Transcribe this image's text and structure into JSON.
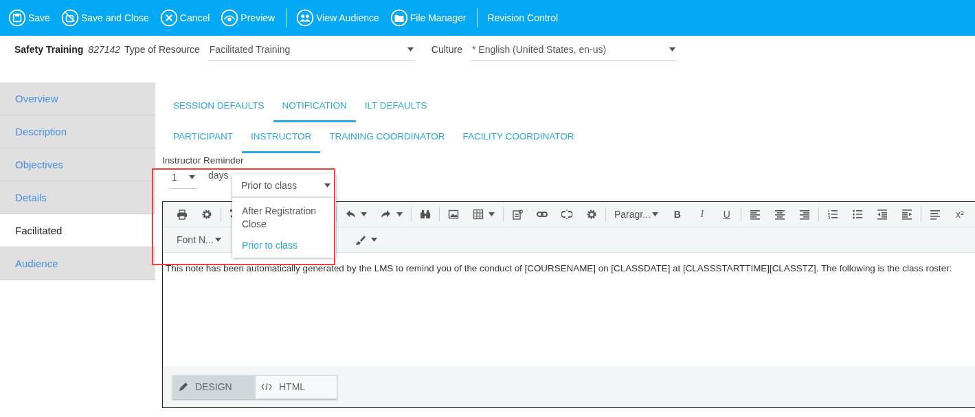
{
  "toolbar": {
    "buttons": [
      {
        "label": "Save"
      },
      {
        "label": "Save and Close"
      },
      {
        "label": "Cancel"
      },
      {
        "label": "Preview"
      },
      {
        "label": "View Audience"
      },
      {
        "label": "File Manager"
      },
      {
        "label": "Revision Control"
      }
    ]
  },
  "header": {
    "title": "Safety Training",
    "code": "827142",
    "type_label": "Type of Resource",
    "type_value": "Facilitated Training",
    "culture_label": "Culture",
    "culture_value": "* English (United States, en-us)"
  },
  "sidebar": {
    "items": [
      {
        "label": "Overview",
        "selected": false
      },
      {
        "label": "Description",
        "selected": false
      },
      {
        "label": "Objectives",
        "selected": false
      },
      {
        "label": "Details",
        "selected": false
      },
      {
        "label": "Facilitated",
        "selected": true
      },
      {
        "label": "Audience",
        "selected": false
      }
    ]
  },
  "tabs": [
    {
      "label": "SESSION DEFAULTS",
      "selected": false
    },
    {
      "label": "NOTIFICATION",
      "selected": true
    },
    {
      "label": "ILT DEFAULTS",
      "selected": false
    }
  ],
  "subtabs": [
    {
      "label": "PARTICIPANT",
      "selected": false
    },
    {
      "label": "INSTRUCTOR",
      "selected": true
    },
    {
      "label": "TRAINING COORDINATOR",
      "selected": false
    },
    {
      "label": "FACILITY COORDINATOR",
      "selected": false
    }
  ],
  "reminder": {
    "label": "Instructor Reminder",
    "count": "1",
    "unit": "days",
    "timing": "Prior to class",
    "options": [
      {
        "label": "After Registration Close",
        "selected": false
      },
      {
        "label": "Prior to class",
        "selected": true
      }
    ]
  },
  "editor": {
    "toolbar_1": [
      {
        "kind": "print"
      },
      {
        "kind": "gear"
      },
      {
        "kind": "sep"
      },
      {
        "kind": "spell"
      },
      {
        "kind": "gap"
      },
      {
        "kind": "sep"
      },
      {
        "kind": "undo"
      },
      {
        "kind": "redo"
      },
      {
        "kind": "sep"
      },
      {
        "kind": "binoculars"
      },
      {
        "kind": "sep"
      },
      {
        "kind": "image"
      },
      {
        "kind": "table"
      },
      {
        "kind": "sep"
      },
      {
        "kind": "paste"
      },
      {
        "kind": "link"
      },
      {
        "kind": "unlink"
      },
      {
        "kind": "gear"
      },
      {
        "kind": "sep"
      },
      {
        "kind": "format",
        "text": "Paragr..."
      },
      {
        "kind": "bold",
        "text": "B"
      },
      {
        "kind": "italic",
        "text": "I"
      },
      {
        "kind": "underline",
        "text": "U"
      },
      {
        "kind": "sep"
      },
      {
        "kind": "alignleft"
      },
      {
        "kind": "aligncenter"
      },
      {
        "kind": "alignright"
      },
      {
        "kind": "sep"
      },
      {
        "kind": "ol"
      },
      {
        "kind": "ul"
      },
      {
        "kind": "outdent"
      },
      {
        "kind": "indent"
      },
      {
        "kind": "sep"
      },
      {
        "kind": "justify"
      },
      {
        "kind": "super",
        "text": "x²"
      }
    ],
    "toolbar_2": [
      {
        "kind": "format",
        "text": "Font N..."
      },
      {
        "kind": "gap"
      },
      {
        "kind": "brush"
      }
    ],
    "body": "This note has been automatically generated by the LMS to remind you of the conduct of [COURSENAME] on [CLASSDATE] at [CLASSSTARTTIME][CLASSTZ]. The following is the class roster:",
    "modes": [
      {
        "label": "DESIGN",
        "selected": true
      },
      {
        "label": "HTML",
        "selected": false
      }
    ]
  }
}
